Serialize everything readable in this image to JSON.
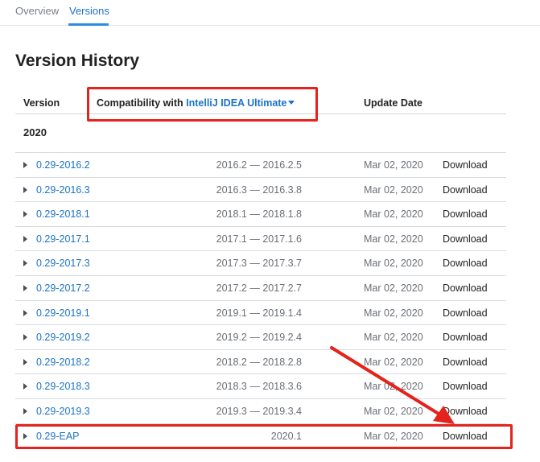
{
  "tabs": [
    {
      "label": "Overview",
      "active": false
    },
    {
      "label": "Versions",
      "active": true
    }
  ],
  "page_title": "Version History",
  "table": {
    "headers": {
      "version": "Version",
      "compat_prefix": "Compatibility with",
      "compat_product": "IntelliJ IDEA Ultimate",
      "update_date": "Update Date"
    },
    "year": "2020",
    "rows": [
      {
        "version": "0.29-2016.2",
        "range": "2016.2 — 2016.2.5",
        "date": "Mar 02, 2020",
        "download": "Download"
      },
      {
        "version": "0.29-2016.3",
        "range": "2016.3 — 2016.3.8",
        "date": "Mar 02, 2020",
        "download": "Download"
      },
      {
        "version": "0.29-2018.1",
        "range": "2018.1 — 2018.1.8",
        "date": "Mar 02, 2020",
        "download": "Download"
      },
      {
        "version": "0.29-2017.1",
        "range": "2017.1 — 2017.1.6",
        "date": "Mar 02, 2020",
        "download": "Download"
      },
      {
        "version": "0.29-2017.3",
        "range": "2017.3 — 2017.3.7",
        "date": "Mar 02, 2020",
        "download": "Download"
      },
      {
        "version": "0.29-2017.2",
        "range": "2017.2 — 2017.2.7",
        "date": "Mar 02, 2020",
        "download": "Download"
      },
      {
        "version": "0.29-2019.1",
        "range": "2019.1 — 2019.1.4",
        "date": "Mar 02, 2020",
        "download": "Download"
      },
      {
        "version": "0.29-2019.2",
        "range": "2019.2 — 2019.2.4",
        "date": "Mar 02, 2020",
        "download": "Download"
      },
      {
        "version": "0.29-2018.2",
        "range": "2018.2 — 2018.2.8",
        "date": "Mar 02, 2020",
        "download": "Download"
      },
      {
        "version": "0.29-2018.3",
        "range": "2018.3 — 2018.3.6",
        "date": "Mar 02, 2020",
        "download": "Download"
      },
      {
        "version": "0.29-2019.3",
        "range": "2019.3 — 2019.3.4",
        "date": "Mar 02, 2020",
        "download": "Download"
      },
      {
        "version": "0.29-EAP",
        "range": "2020.1",
        "date": "Mar 02, 2020",
        "download": "Download"
      }
    ]
  },
  "colors": {
    "link": "#1a73c8",
    "annotation": "#e5221b"
  }
}
